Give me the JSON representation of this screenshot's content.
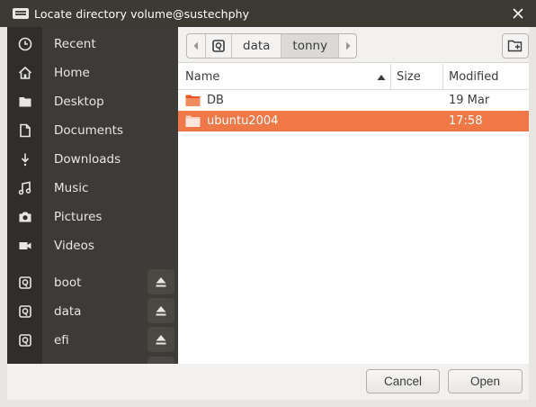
{
  "window": {
    "title": "Locate directory volume@sustechphy",
    "close_icon": "close-icon",
    "app_icon": "app-icon"
  },
  "sidebar": {
    "places": [
      {
        "label": "Recent",
        "icon": "clock-icon"
      },
      {
        "label": "Home",
        "icon": "home-icon"
      },
      {
        "label": "Desktop",
        "icon": "folder-icon"
      },
      {
        "label": "Documents",
        "icon": "document-icon"
      },
      {
        "label": "Downloads",
        "icon": "download-icon"
      },
      {
        "label": "Music",
        "icon": "music-icon"
      },
      {
        "label": "Pictures",
        "icon": "camera-icon"
      },
      {
        "label": "Videos",
        "icon": "video-icon"
      }
    ],
    "devices": [
      {
        "label": "boot",
        "icon": "drive-icon",
        "eject": true
      },
      {
        "label": "data",
        "icon": "drive-icon",
        "eject": true
      },
      {
        "label": "efi",
        "icon": "drive-icon",
        "eject": true
      }
    ]
  },
  "pathbar": {
    "segments": [
      "data",
      "tonny"
    ],
    "active": "tonny"
  },
  "columns": {
    "name": "Name",
    "size": "Size",
    "modified": "Modified",
    "sort": "ascending"
  },
  "files": [
    {
      "name": "DB",
      "size": "",
      "modified": "19 Mar",
      "selected": false
    },
    {
      "name": "ubuntu2004",
      "size": "",
      "modified": "17:58",
      "selected": true
    }
  ],
  "buttons": {
    "cancel": "Cancel",
    "open": "Open"
  },
  "colors": {
    "selection": "#f07746",
    "sidebar_bg": "#3c3b37",
    "titlebar_bg": "#3d3a34",
    "folder": "#e95420"
  }
}
